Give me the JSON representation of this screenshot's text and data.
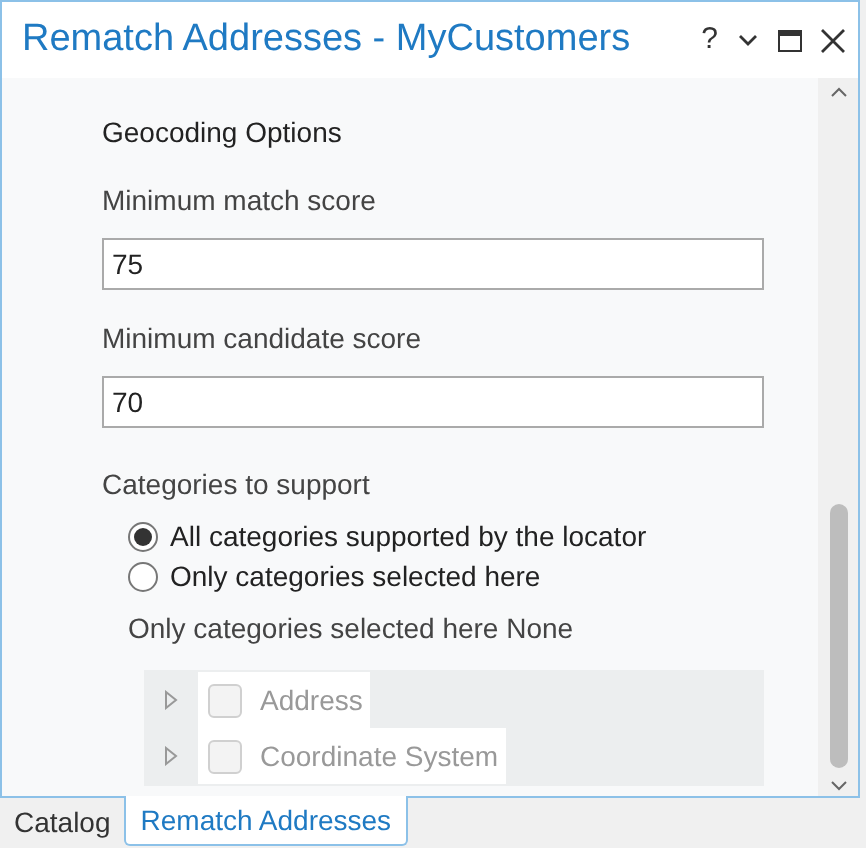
{
  "window": {
    "title": "Rematch Addresses - MyCustomers",
    "controls": [
      "?"
    ]
  },
  "section_title": "Geocoding Options",
  "fields": [
    {
      "label": "Minimum match score",
      "value": "75"
    },
    {
      "label": "Minimum candidate score",
      "value": "70"
    }
  ],
  "categories": {
    "label": "Categories to support",
    "options": [
      {
        "label": "All categories supported by the locator",
        "selected": true
      },
      {
        "label": "Only categories selected here",
        "selected": false
      }
    ],
    "list_label": "Only categories selected here None",
    "items": [
      {
        "label": "Address",
        "checked": false,
        "disabled": true,
        "expanded": false
      },
      {
        "label": "Coordinate System",
        "checked": false,
        "disabled": true,
        "expanded": false
      }
    ]
  },
  "tabs": [
    {
      "label": "Catalog",
      "selected": false
    },
    {
      "label": "Rematch Addresses",
      "selected": true
    }
  ]
}
